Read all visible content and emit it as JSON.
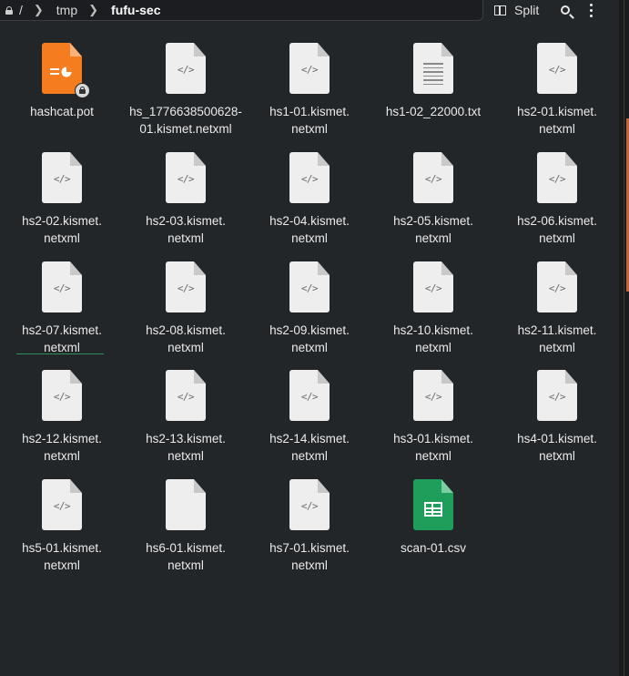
{
  "breadcrumb": {
    "root": "/",
    "items": [
      "tmp",
      "fufu-sec"
    ]
  },
  "toolbar": {
    "split_label": "Split",
    "split_icon": "split-view-icon",
    "search_icon": "search-icon",
    "menu_icon": "kebab-menu-icon"
  },
  "files": [
    {
      "name": "hashcat.pot",
      "icon": "presentation-icon",
      "locked": true
    },
    {
      "name": "hs_1776638500628-01.kismet.netxml",
      "icon": "code-file-icon"
    },
    {
      "name": "hs1-01.kismet.netxml",
      "icon": "code-file-icon"
    },
    {
      "name": "hs1-02_22000.txt",
      "icon": "text-file-icon"
    },
    {
      "name": "hs2-01.kismet.netxml",
      "icon": "code-file-icon"
    },
    {
      "name": "hs2-02.kismet.netxml",
      "icon": "code-file-icon"
    },
    {
      "name": "hs2-03.kismet.netxml",
      "icon": "code-file-icon"
    },
    {
      "name": "hs2-04.kismet.netxml",
      "icon": "code-file-icon"
    },
    {
      "name": "hs2-05.kismet.netxml",
      "icon": "code-file-icon"
    },
    {
      "name": "hs2-06.kismet.netxml",
      "icon": "code-file-icon"
    },
    {
      "name": "hs2-07.kismet.netxml",
      "icon": "code-file-icon"
    },
    {
      "name": "hs2-08.kismet.netxml",
      "icon": "code-file-icon"
    },
    {
      "name": "hs2-09.kismet.netxml",
      "icon": "code-file-icon"
    },
    {
      "name": "hs2-10.kismet.netxml",
      "icon": "code-file-icon"
    },
    {
      "name": "hs2-11.kismet.netxml",
      "icon": "code-file-icon"
    },
    {
      "name": "hs2-12.kismet.netxml",
      "icon": "code-file-icon"
    },
    {
      "name": "hs2-13.kismet.netxml",
      "icon": "code-file-icon"
    },
    {
      "name": "hs2-14.kismet.netxml",
      "icon": "code-file-icon"
    },
    {
      "name": "hs3-01.kismet.netxml",
      "icon": "code-file-icon"
    },
    {
      "name": "hs4-01.kismet.netxml",
      "icon": "code-file-icon"
    },
    {
      "name": "hs5-01.kismet.netxml",
      "icon": "code-file-icon"
    },
    {
      "name": "hs6-01.kismet.netxml",
      "icon": "blank-file-icon"
    },
    {
      "name": "hs7-01.kismet.netxml",
      "icon": "code-file-icon"
    },
    {
      "name": "scan-01.csv",
      "icon": "spreadsheet-icon"
    }
  ],
  "file_lines": [
    [
      "hashcat.pot"
    ],
    [
      "hs_1776638500628-",
      "01.kismet.netxml"
    ],
    [
      "hs1-01.kismet.",
      "netxml"
    ],
    [
      "hs1-02_22000.txt"
    ],
    [
      "hs2-01.kismet.",
      "netxml"
    ],
    [
      "hs2-02.kismet.",
      "netxml"
    ],
    [
      "hs2-03.kismet.",
      "netxml"
    ],
    [
      "hs2-04.kismet.",
      "netxml"
    ],
    [
      "hs2-05.kismet.",
      "netxml"
    ],
    [
      "hs2-06.kismet.",
      "netxml"
    ],
    [
      "hs2-07.kismet.",
      "netxml"
    ],
    [
      "hs2-08.kismet.",
      "netxml"
    ],
    [
      "hs2-09.kismet.",
      "netxml"
    ],
    [
      "hs2-10.kismet.",
      "netxml"
    ],
    [
      "hs2-11.kismet.",
      "netxml"
    ],
    [
      "hs2-12.kismet.",
      "netxml"
    ],
    [
      "hs2-13.kismet.",
      "netxml"
    ],
    [
      "hs2-14.kismet.",
      "netxml"
    ],
    [
      "hs3-01.kismet.",
      "netxml"
    ],
    [
      "hs4-01.kismet.",
      "netxml"
    ],
    [
      "hs5-01.kismet.",
      "netxml"
    ],
    [
      "hs6-01.kismet.",
      "netxml"
    ],
    [
      "hs7-01.kismet.",
      "netxml"
    ],
    [
      "scan-01.csv"
    ]
  ],
  "code_glyph": "</>"
}
